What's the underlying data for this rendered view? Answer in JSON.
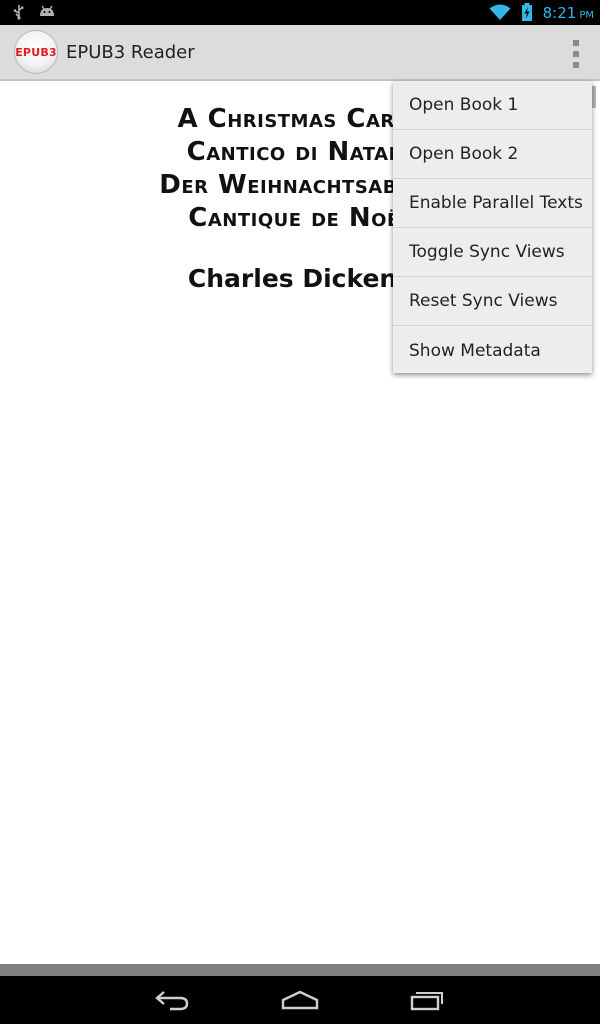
{
  "status_bar": {
    "left_icons": [
      "usb-icon",
      "android-debug-icon"
    ],
    "right_icons": [
      "wifi-icon",
      "battery-charging-icon"
    ],
    "time": "8:21",
    "ampm": "PM",
    "accent_color": "#33b5e5"
  },
  "action_bar": {
    "logo_text": "EPUB3",
    "title": "EPUB3 Reader",
    "overflow_icon": "overflow-menu-icon"
  },
  "book": {
    "titles": [
      "A Christmas Carol",
      "Cantico di Natale",
      "Der Weihnachtsabend",
      "Cantique de Noël"
    ],
    "author": "Charles Dickens"
  },
  "overflow_menu": {
    "items": [
      "Open Book 1",
      "Open Book 2",
      "Enable Parallel Texts",
      "Toggle Sync Views",
      "Reset Sync Views",
      "Show Metadata"
    ]
  },
  "nav_bar": {
    "buttons": [
      "back-icon",
      "home-icon",
      "recent-apps-icon"
    ]
  }
}
